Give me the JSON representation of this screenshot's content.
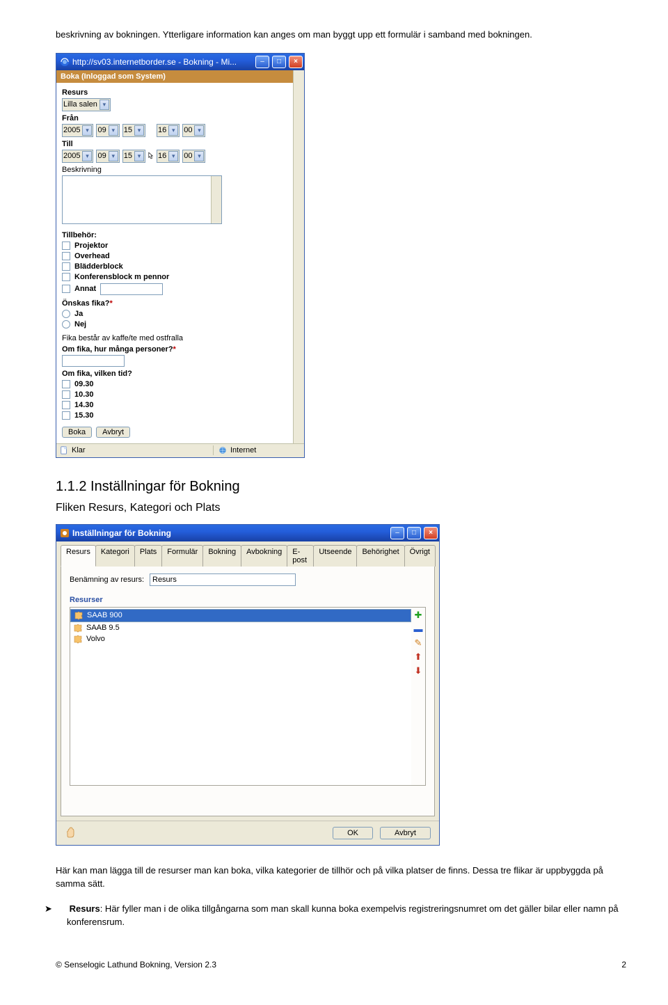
{
  "intro_text": "beskrivning av bokningen. Ytterligare information kan anges om man byggt upp ett formulär i samband med bokningen.",
  "window1": {
    "title": "http://sv03.internetborder.se - Bokning - Mi...",
    "header": "Boka (Inloggad som System)",
    "labels": {
      "resurs": "Resurs",
      "fran": "Från",
      "till": "Till",
      "beskrivning": "Beskrivning",
      "tillbehor": "Tillbehör:",
      "onskas_fika": "Önskas fika?",
      "fika_info": "Fika består av kaffe/te med ostfralla",
      "om_fika_personer": "Om fika, hur många personer?",
      "om_fika_tid": "Om fika, vilken tid?"
    },
    "resurs_value": "Lilla salen",
    "fran_values": {
      "year": "2005",
      "month": "09",
      "day": "15",
      "hour": "16",
      "minute": "00"
    },
    "till_values": {
      "year": "2005",
      "month": "09",
      "day": "15",
      "hour": "16",
      "minute": "00"
    },
    "tillbehor_options": [
      "Projektor",
      "Overhead",
      "Blädderblock",
      "Konferensblock m pennor",
      "Annat"
    ],
    "fika_options": [
      "Ja",
      "Nej"
    ],
    "tid_options": [
      "09.30",
      "10.30",
      "14.30",
      "15.30"
    ],
    "buttons": {
      "boka": "Boka",
      "avbryt": "Avbryt"
    },
    "status": {
      "klar": "Klar",
      "zone": "Internet"
    }
  },
  "heading_1": "1.1.2 Inställningar för Bokning",
  "heading_2": "Fliken Resurs, Kategori och Plats",
  "window2": {
    "title": "Inställningar för Bokning",
    "tabs": [
      "Resurs",
      "Kategori",
      "Plats",
      "Formulär",
      "Bokning",
      "Avbokning",
      "E-post",
      "Utseende",
      "Behörighet",
      "Övrigt"
    ],
    "active_tab": 0,
    "field_label": "Benämning av resurs:",
    "field_value": "Resurs",
    "list_header": "Resurser",
    "items": [
      "SAAB 900",
      "SAAB 9.5",
      "Volvo"
    ],
    "selected_index": 0,
    "buttons": {
      "ok": "OK",
      "cancel": "Avbryt"
    }
  },
  "para2": "Här kan man lägga till de resurser man kan boka, vilka kategorier de tillhör och på vilka  platser de finns. Dessa tre flikar är uppbyggda på samma sätt.",
  "bullet": {
    "strong": "Resurs",
    "rest": ": Här fyller man i de olika tillgångarna som man skall kunna boka exempelvis registreringsnumret om det gäller bilar eller namn på konferensrum."
  },
  "footer": {
    "left": "© Senselogic Lathund Bokning, Version 2.3",
    "right": "2"
  }
}
